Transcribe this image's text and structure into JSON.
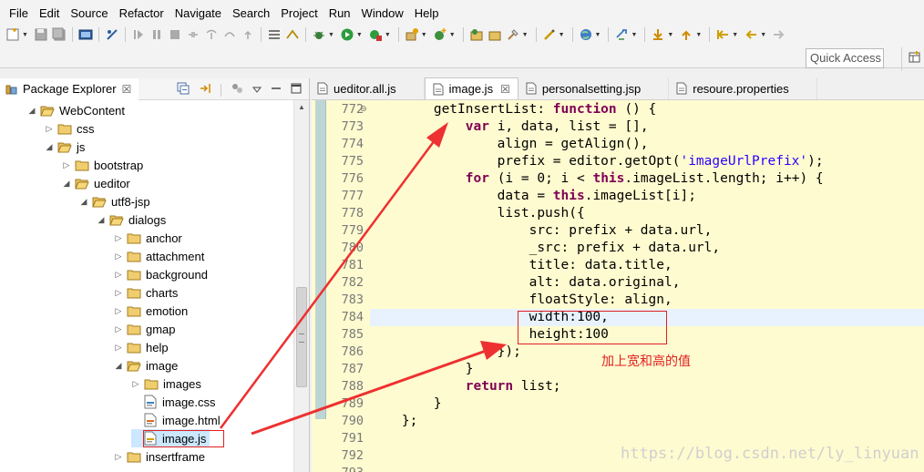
{
  "menu": [
    "File",
    "Edit",
    "Source",
    "Refactor",
    "Navigate",
    "Search",
    "Project",
    "Run",
    "Window",
    "Help"
  ],
  "toolbar": {
    "quick_access_label": "Quick Access"
  },
  "package_explorer": {
    "title": "Package Explorer",
    "close_glyph": "☒",
    "tree": [
      {
        "label": "WebContent",
        "kind": "folder",
        "depth": 0,
        "expanded": true
      },
      {
        "label": "css",
        "kind": "folder",
        "depth": 1,
        "expanded": false
      },
      {
        "label": "js",
        "kind": "folder",
        "depth": 1,
        "expanded": true
      },
      {
        "label": "bootstrap",
        "kind": "folder",
        "depth": 2,
        "expanded": false
      },
      {
        "label": "ueditor",
        "kind": "folder",
        "depth": 2,
        "expanded": true
      },
      {
        "label": "utf8-jsp",
        "kind": "folder",
        "depth": 3,
        "expanded": true
      },
      {
        "label": "dialogs",
        "kind": "folder",
        "depth": 4,
        "expanded": true
      },
      {
        "label": "anchor",
        "kind": "folder",
        "depth": 5,
        "expanded": false
      },
      {
        "label": "attachment",
        "kind": "folder",
        "depth": 5,
        "expanded": false
      },
      {
        "label": "background",
        "kind": "folder",
        "depth": 5,
        "expanded": false
      },
      {
        "label": "charts",
        "kind": "folder",
        "depth": 5,
        "expanded": false
      },
      {
        "label": "emotion",
        "kind": "folder",
        "depth": 5,
        "expanded": false
      },
      {
        "label": "gmap",
        "kind": "folder",
        "depth": 5,
        "expanded": false
      },
      {
        "label": "help",
        "kind": "folder",
        "depth": 5,
        "expanded": false
      },
      {
        "label": "image",
        "kind": "folder",
        "depth": 5,
        "expanded": true
      },
      {
        "label": "images",
        "kind": "folder",
        "depth": 6,
        "expanded": false
      },
      {
        "label": "image.css",
        "kind": "css",
        "depth": 6
      },
      {
        "label": "image.html",
        "kind": "html",
        "depth": 6
      },
      {
        "label": "image.js",
        "kind": "js",
        "depth": 6,
        "selected": true
      },
      {
        "label": "insertframe",
        "kind": "folder",
        "depth": 5,
        "expanded": false
      }
    ]
  },
  "editor": {
    "tabs": [
      {
        "label": "ueditor.all.js",
        "active": false,
        "closable": false
      },
      {
        "label": "image.js",
        "active": true,
        "closable": true
      },
      {
        "label": "personalsetting.jsp",
        "active": false,
        "closable": false
      },
      {
        "label": "resoure.properties",
        "active": false,
        "closable": false
      }
    ],
    "close_glyph": "☒",
    "fold_marker": "⊖",
    "current_line": 784,
    "lines": [
      {
        "n": "772",
        "segs": [
          [
            "p",
            "        getInsertList: "
          ],
          [
            "k",
            "function"
          ],
          [
            "p",
            " () {"
          ]
        ]
      },
      {
        "n": "773",
        "segs": [
          [
            "p",
            "            "
          ],
          [
            "k",
            "var"
          ],
          [
            "p",
            " i, data, list = [],"
          ]
        ]
      },
      {
        "n": "774",
        "segs": [
          [
            "p",
            "                align = getAlign(),"
          ]
        ]
      },
      {
        "n": "775",
        "segs": [
          [
            "p",
            "                prefix = editor.getOpt("
          ],
          [
            "s",
            "'imageUrlPrefix'"
          ],
          [
            "p",
            ");"
          ]
        ]
      },
      {
        "n": "776",
        "segs": [
          [
            "p",
            "            "
          ],
          [
            "k",
            "for"
          ],
          [
            "p",
            " (i = 0; i < "
          ],
          [
            "k",
            "this"
          ],
          [
            "p",
            ".imageList.length; i++) {"
          ]
        ]
      },
      {
        "n": "777",
        "segs": [
          [
            "p",
            "                data = "
          ],
          [
            "k",
            "this"
          ],
          [
            "p",
            ".imageList[i];"
          ]
        ]
      },
      {
        "n": "778",
        "segs": [
          [
            "p",
            "                list.push({"
          ]
        ]
      },
      {
        "n": "779",
        "segs": [
          [
            "p",
            "                    src: prefix + data.url,"
          ]
        ]
      },
      {
        "n": "780",
        "segs": [
          [
            "p",
            "                    _src: prefix + data.url,"
          ]
        ]
      },
      {
        "n": "781",
        "segs": [
          [
            "p",
            "                    title: data.title,"
          ]
        ]
      },
      {
        "n": "782",
        "segs": [
          [
            "p",
            "                    alt: data.original,"
          ]
        ]
      },
      {
        "n": "783",
        "segs": [
          [
            "p",
            "                    floatStyle: align,"
          ]
        ]
      },
      {
        "n": "784",
        "segs": [
          [
            "p",
            "                    width:100,"
          ]
        ]
      },
      {
        "n": "785",
        "segs": [
          [
            "p",
            "                    height:100"
          ]
        ]
      },
      {
        "n": "786",
        "segs": [
          [
            "p",
            "                });"
          ]
        ]
      },
      {
        "n": "787",
        "segs": [
          [
            "p",
            "            }"
          ]
        ]
      },
      {
        "n": "788",
        "segs": [
          [
            "p",
            "            "
          ],
          [
            "k",
            "return"
          ],
          [
            "p",
            " list;"
          ]
        ]
      },
      {
        "n": "789",
        "segs": [
          [
            "p",
            "        }"
          ]
        ]
      },
      {
        "n": "790",
        "segs": [
          [
            "p",
            "    };"
          ]
        ]
      },
      {
        "n": "791",
        "segs": [
          [
            "p",
            ""
          ]
        ]
      },
      {
        "n": "792",
        "segs": [
          [
            "p",
            ""
          ]
        ]
      },
      {
        "n": "793",
        "segs": [
          [
            "p",
            ""
          ]
        ]
      }
    ]
  },
  "annotation": {
    "note": "加上宽和高的值",
    "color": "#e02020"
  },
  "watermark": "https://blog.csdn.net/ly_linyuan",
  "colors": {
    "editor_bg": "#fffbd0",
    "current_line": "#e8f2fe",
    "keyword": "#7f0055",
    "string": "#2a00ff",
    "line_number": "#787878",
    "selected_bg": "#cce8ff"
  }
}
